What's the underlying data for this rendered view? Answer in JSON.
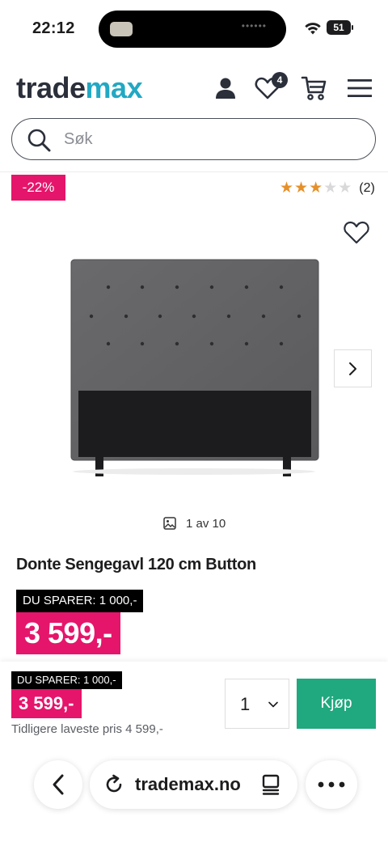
{
  "status_bar": {
    "time": "22:12",
    "battery": "51"
  },
  "header": {
    "logo_part1": "trade",
    "logo_part2": "max",
    "wishlist_count": "4",
    "icons": [
      "user-icon",
      "heart-icon",
      "cart-icon",
      "menu-icon"
    ]
  },
  "search": {
    "placeholder": "Søk"
  },
  "product": {
    "discount_badge": "-22%",
    "rating_stars": 3,
    "rating_max": 5,
    "review_count": "(2)",
    "image_counter": "1 av 10",
    "title": "Donte Sengegavl 120 cm Button",
    "savings": "DU SPARER: 1 000,-",
    "price": "3 599,-"
  },
  "buy_bar": {
    "savings": "DU SPARER: 1 000,-",
    "price": "3 599,-",
    "previous_price": "Tidligere laveste pris 4 599,-",
    "quantity": "1",
    "buy_label": "Kjøp"
  },
  "browser": {
    "url": "trademax.no"
  },
  "colors": {
    "accent_pink": "#e5156b",
    "buy_green": "#20a87e",
    "logo_blue": "#22a8c3",
    "star_orange": "#e6902a"
  }
}
